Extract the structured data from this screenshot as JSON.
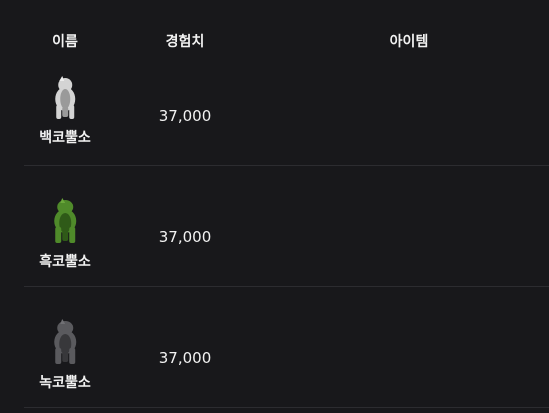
{
  "columns": {
    "name": "이름",
    "exp": "경험치",
    "item": "아이템"
  },
  "monsters": [
    {
      "name": "백코뿔소",
      "exp": "37,000",
      "icon": "white-rhino-icon",
      "color": "#d4d4d4",
      "shade": "#9a9a9a"
    },
    {
      "name": "흑코뿔소",
      "exp": "37,000",
      "icon": "green-rhino-icon",
      "color": "#4f8a2a",
      "shade": "#2f5a18"
    },
    {
      "name": "녹코뿔소",
      "exp": "37,000",
      "icon": "gray-rhino-icon",
      "color": "#5a5a5e",
      "shade": "#38383b"
    }
  ]
}
